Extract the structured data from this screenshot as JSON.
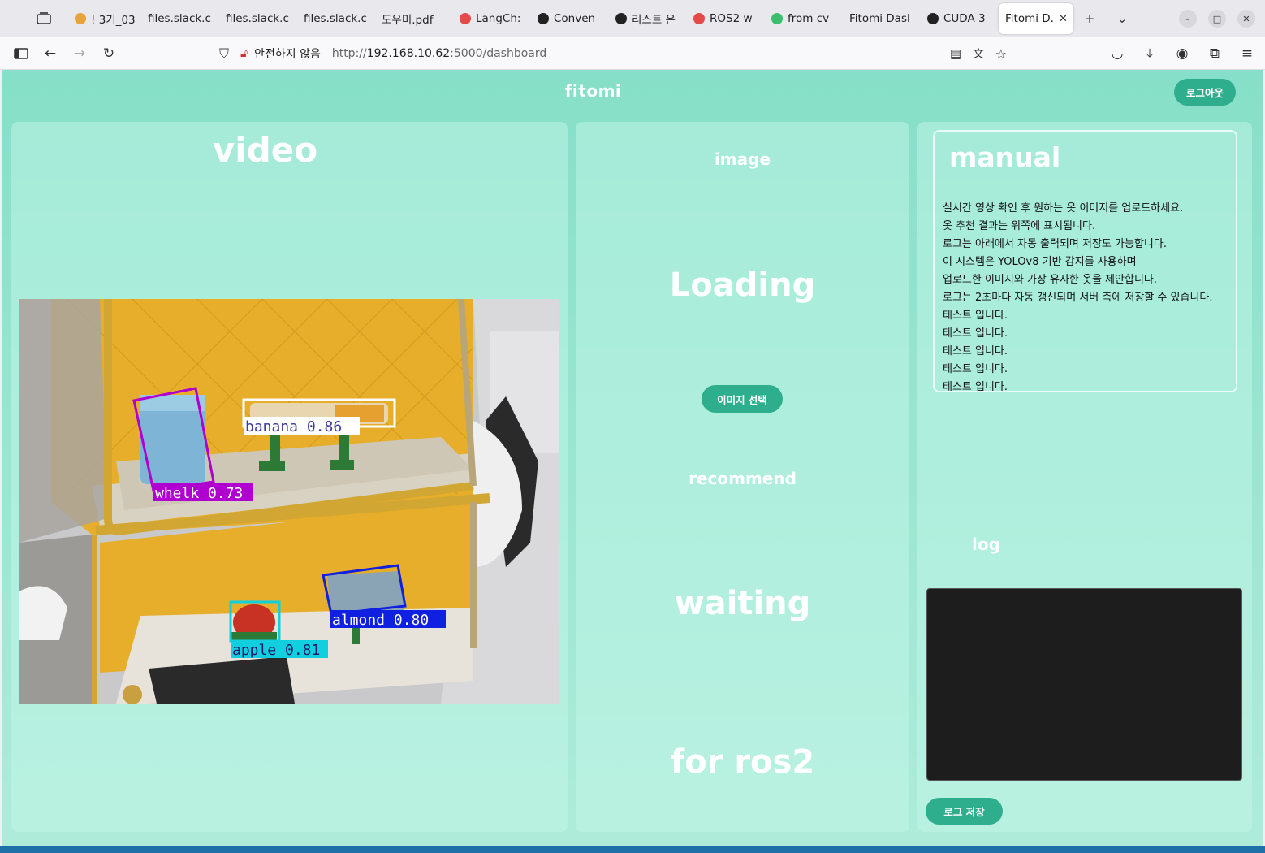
{
  "browser": {
    "tabs": [
      {
        "label": "! 3기_03",
        "fav": "#e8a33a"
      },
      {
        "label": "files.slack.c",
        "fav": ""
      },
      {
        "label": "files.slack.c",
        "fav": ""
      },
      {
        "label": "files.slack.c",
        "fav": ""
      },
      {
        "label": "도우미.pdf",
        "fav": ""
      },
      {
        "label": "LangCh:",
        "fav": "#e34a4a"
      },
      {
        "label": "Conven",
        "fav": "#222222"
      },
      {
        "label": "리스트 은",
        "fav": "#222222"
      },
      {
        "label": "ROS2 w",
        "fav": "#e34a4a"
      },
      {
        "label": "from cv",
        "fav": "#3bbf6f"
      },
      {
        "label": "Fitomi Dasl",
        "fav": ""
      },
      {
        "label": "CUDA 3",
        "fav": "#222222"
      },
      {
        "label": "Fitomi D.",
        "fav": "",
        "active": true
      }
    ],
    "security_text": "안전하지 않음",
    "url_prefix": "http://",
    "url_host": "192.168.10.62",
    "url_path": ":5000/dashboard"
  },
  "header": {
    "brand": "fitomi",
    "logout_label": "로그아웃"
  },
  "video_panel": {
    "title": "video",
    "detections": [
      {
        "label": "whelk 0.73",
        "color": "#b000d0"
      },
      {
        "label": "banana 0.86",
        "color": "#ffffff"
      },
      {
        "label": "almond 0.80",
        "color": "#1020e0"
      },
      {
        "label": "apple 0.81",
        "color": "#10d0e0"
      }
    ]
  },
  "middle_panel": {
    "image_label": "image",
    "loading_text": "Loading",
    "pick_image_label": "이미지 선택",
    "recommend_label": "recommend",
    "waiting_text": "waiting",
    "ros2_text": "for ros2"
  },
  "right_panel": {
    "manual_title": "manual",
    "manual_lines": [
      "실시간 영상 확인 후 원하는 옷 이미지를 업로드하세요.",
      "옷 추천 결과는 위쪽에 표시됩니다.",
      "로그는 아래에서 자동 출력되며 저장도 가능합니다.",
      "이 시스템은 YOLOv8 기반 감지를 사용하며",
      "업로드한 이미지와 가장 유사한 옷을 제안합니다.",
      "로그는 2초마다 자동 갱신되며 서버 측에 저장할 수 있습니다.",
      "테스트 입니다.",
      "테스트 입니다.",
      "테스트 입니다.",
      "테스트 입니다.",
      "테스트 입니다."
    ],
    "log_label": "log",
    "save_log_label": "로그 저장"
  },
  "colors": {
    "accent": "#2fae8e",
    "page_bg": "#86dfc8",
    "log_bg": "#1d1d1d"
  }
}
